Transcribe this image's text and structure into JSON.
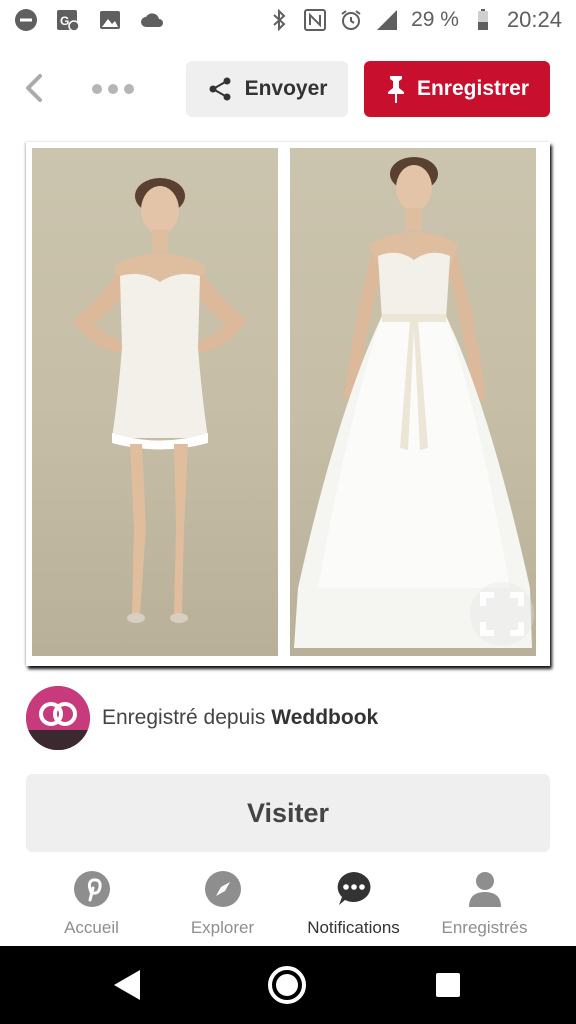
{
  "status_bar": {
    "battery_percent": "29 %",
    "time": "20:24",
    "icons": [
      "do-not-disturb-icon",
      "maps-icon",
      "gallery-icon",
      "cloud-icon",
      "bluetooth-icon",
      "nfc-icon",
      "alarm-icon",
      "signal-icon",
      "battery-icon"
    ]
  },
  "actions": {
    "send_label": "Envoyer",
    "save_label": "Enregistrer"
  },
  "pin": {
    "source_prefix": "Enregistré depuis ",
    "source_name": "Weddbook"
  },
  "visit": {
    "label": "Visiter"
  },
  "tabs": [
    {
      "label": "Accueil",
      "icon": "pinterest-icon",
      "active": false
    },
    {
      "label": "Explorer",
      "icon": "compass-icon",
      "active": false
    },
    {
      "label": "Notifications",
      "icon": "chat-bubble-icon",
      "active": true
    },
    {
      "label": "Enregistrés",
      "icon": "profile-icon",
      "active": false
    }
  ],
  "colors": {
    "brand_red": "#c8102e",
    "button_gray": "#efefef",
    "tab_inactive": "#8e8e8e",
    "tab_active": "#333333"
  }
}
